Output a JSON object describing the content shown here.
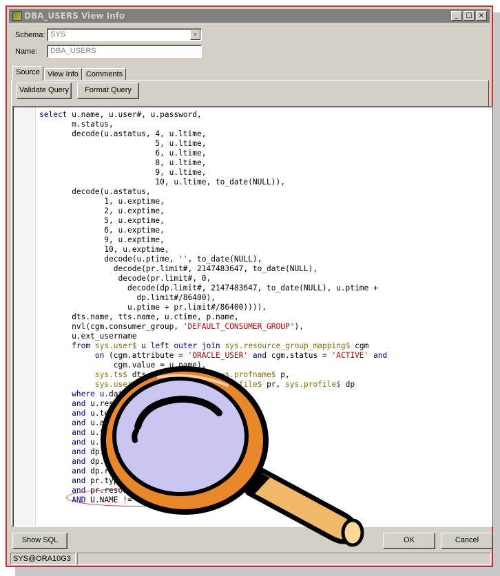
{
  "window": {
    "title": "DBA_USERS View Info",
    "controls": [
      "_",
      "□",
      "×"
    ]
  },
  "form": {
    "schema_label": "Schema:",
    "schema_value": "SYS",
    "name_label": "Name:",
    "name_value": "DBA_USERS"
  },
  "tabs": [
    "Source",
    "View Info",
    "Comments"
  ],
  "active_tab": "Source",
  "toolbar": {
    "validate_label": "Validate Query",
    "format_label": "Format Query"
  },
  "footer": {
    "show_sql_label": "Show SQL",
    "ok_label": "OK",
    "cancel_label": "Cancel",
    "status": "SYS@ORA10G3"
  },
  "sql_lines": [
    "select u.name, u.user#, u.password,",
    "       m.status,",
    "       decode(u.astatus, 4, u.ltime,",
    "                         5, u.ltime,",
    "                         6, u.ltime,",
    "                         8, u.ltime,",
    "                         9, u.ltime,",
    "                         10, u.ltime, to_date(NULL)),",
    "       decode(u.astatus,",
    "              1, u.exptime,",
    "              2, u.exptime,",
    "              5, u.exptime,",
    "              6, u.exptime,",
    "              9, u.exptime,",
    "              10, u.exptime,",
    "              decode(u.ptime, '', to_date(NULL),",
    "                decode(pr.limit#, 2147483647, to_date(NULL),",
    "                 decode(pr.limit#, 0,",
    "                   decode(dp.limit#, 2147483647, to_date(NULL), u.ptime +",
    "                     dp.limit#/86400),",
    "                   u.ptime + pr.limit#/86400)))),",
    "       dts.name, tts.name, u.ctime, p.name,",
    "       nvl(cgm.consumer_group, 'DEFAULT_CONSUMER_GROUP'),",
    "       u.ext_username",
    "       from sys.user$ u left outer join sys.resource_group_mapping$ cgm",
    "            on (cgm.attribute = 'ORACLE_USER' and cgm.status = 'ACTIVE' and",
    "                cgm.value = u.name),",
    "            sys.ts$ dts, sys.ts$ tts, sys.profname$ p,",
    "            sys.user_astatus_map m, sys.profile$ pr, sys.profile$ dp",
    "       where u.datats# = dts.ts#",
    "       and u.resource$ = p.profile#",
    "       and u.tempts# = tts.ts#",
    "       and u.astatus = m.status#",
    "       and u.type# = 1",
    "       and u.resource$ = pr.profile#",
    "       and dp.profile# = 0",
    "       and dp.type# = 1",
    "       and dp.resource# = 1",
    "       and pr.type# = 1",
    "       and pr.resource# = 1",
    "       AND U.NAME != 'HACKER'"
  ],
  "annotation_color": "#e03030",
  "magnifier": {
    "rim_color": "#e8882a",
    "lens_color": "#c9c6f2",
    "handle_color": "#f0b868"
  }
}
